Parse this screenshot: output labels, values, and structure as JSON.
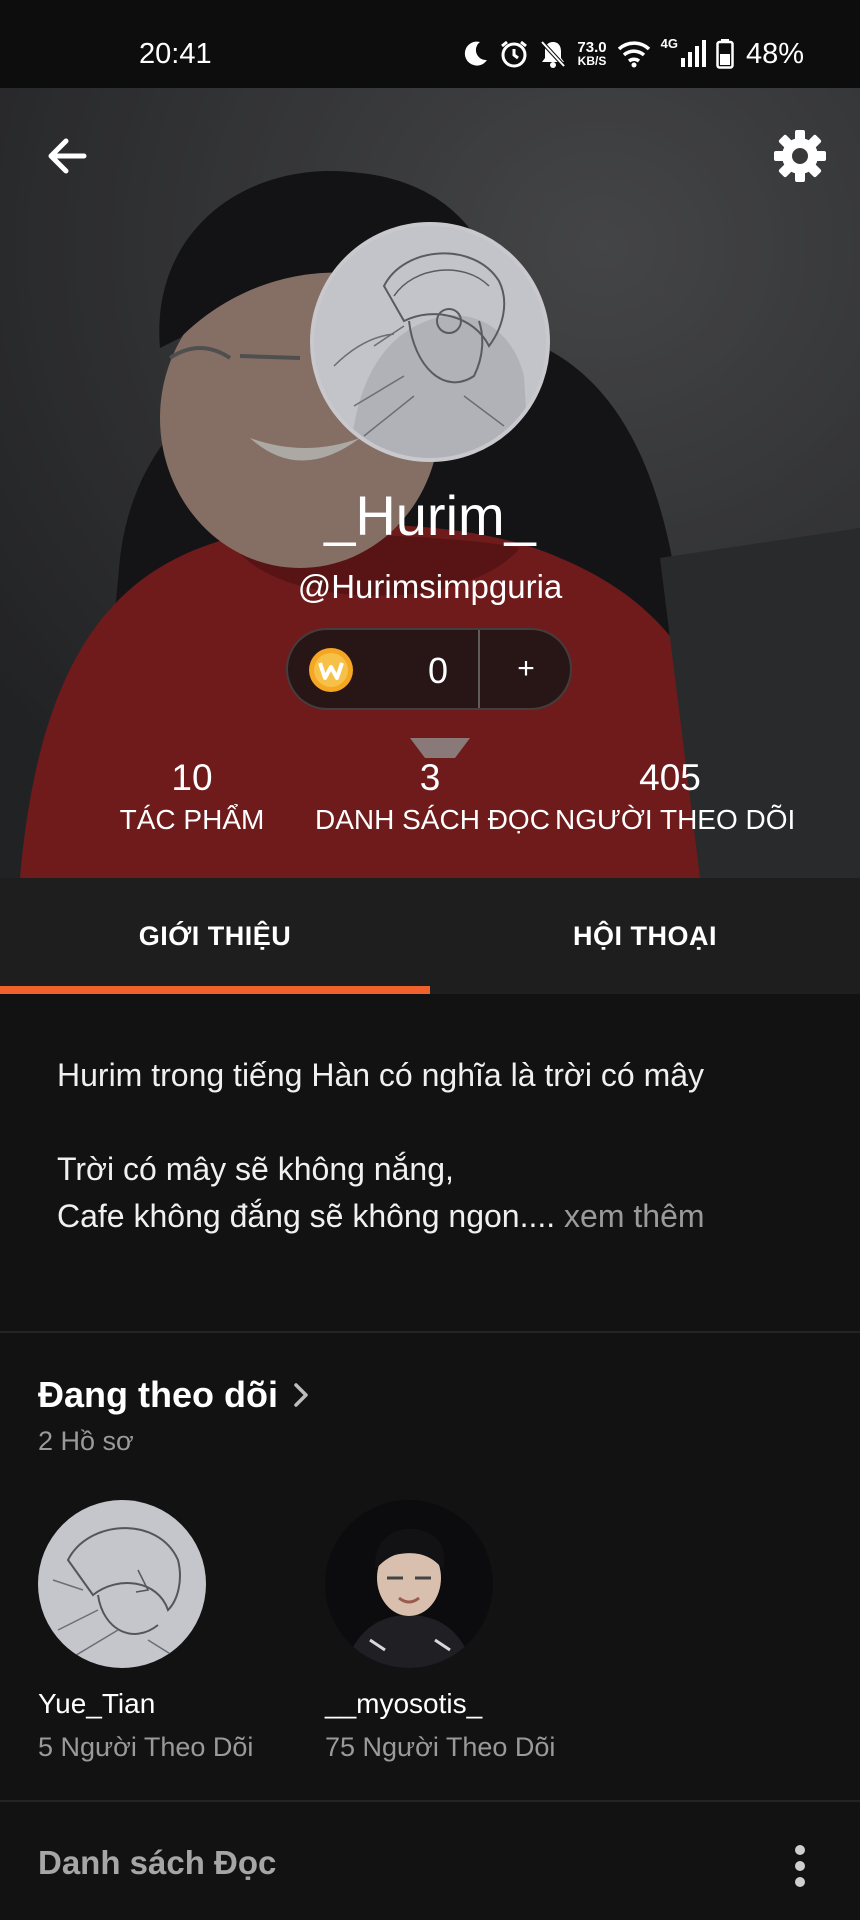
{
  "status_bar": {
    "time": "20:41",
    "net_speed_value": "73.0",
    "net_speed_unit": "KB/S",
    "network_type": "4G",
    "battery": "48%"
  },
  "profile": {
    "display_name": "_Hurim_",
    "username": "@Hurimsimpguria",
    "coins": "0",
    "coin_add_label": "+",
    "stats": [
      {
        "value": "10",
        "label": "TÁC PHẨM"
      },
      {
        "value": "3",
        "label": "DANH SÁCH ĐỌC"
      },
      {
        "value": "405",
        "label": "NGƯỜI THEO DÕI"
      }
    ]
  },
  "tabs": [
    {
      "label": "GIỚI THIỆU",
      "active": true
    },
    {
      "label": "HỘI THOẠI",
      "active": false
    }
  ],
  "about": {
    "line1": "Hurim trong tiếng Hàn có nghĩa là trời có mây",
    "line2": "Trời có mây sẽ không nắng,",
    "line3": "Cafe không đắng sẽ không ngon....",
    "see_more": "xem thêm"
  },
  "following": {
    "title": "Đang theo dõi",
    "count": "2 Hồ sơ",
    "users": [
      {
        "name": "Yue_Tian",
        "followers": "5 Người Theo Dõi"
      },
      {
        "name": "__myosotis_",
        "followers": "75 Người Theo Dõi"
      }
    ]
  },
  "reading_list": {
    "title": "Danh sách Đọc"
  },
  "colors": {
    "accent": "#f0612b",
    "background": "#121212",
    "tab_bar": "#1e1e1e",
    "muted_text": "#9a9a9a"
  }
}
